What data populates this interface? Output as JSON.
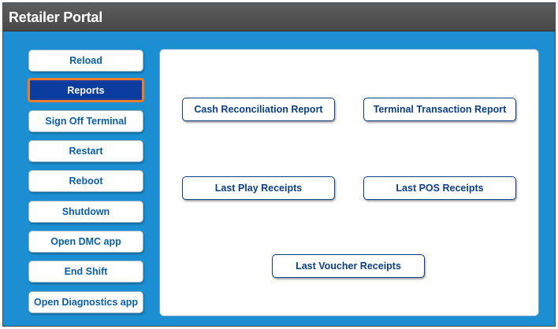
{
  "window": {
    "title": "Retailer Portal"
  },
  "colors": {
    "background": "#1b8fd2",
    "titlebar": "#4f4f4f",
    "selected_fill": "#0a3d9e",
    "selected_border": "#f27b2a",
    "sidebar_text": "#0a5ea6",
    "report_text": "#0b3f86"
  },
  "sidebar": {
    "selected": "Reports",
    "items": [
      {
        "label": "Reload"
      },
      {
        "label": "Reports"
      },
      {
        "label": "Sign Off Terminal"
      },
      {
        "label": "Restart"
      },
      {
        "label": "Reboot"
      },
      {
        "label": "Shutdown"
      },
      {
        "label": "Open DMC app"
      },
      {
        "label": "End Shift"
      },
      {
        "label": "Open Diagnostics app"
      }
    ]
  },
  "reports": {
    "buttons": [
      {
        "label": "Cash Reconciliation Report"
      },
      {
        "label": "Terminal Transaction Report"
      },
      {
        "label": "Last Play Receipts"
      },
      {
        "label": "Last POS Receipts"
      },
      {
        "label": "Last Voucher Receipts"
      }
    ]
  }
}
